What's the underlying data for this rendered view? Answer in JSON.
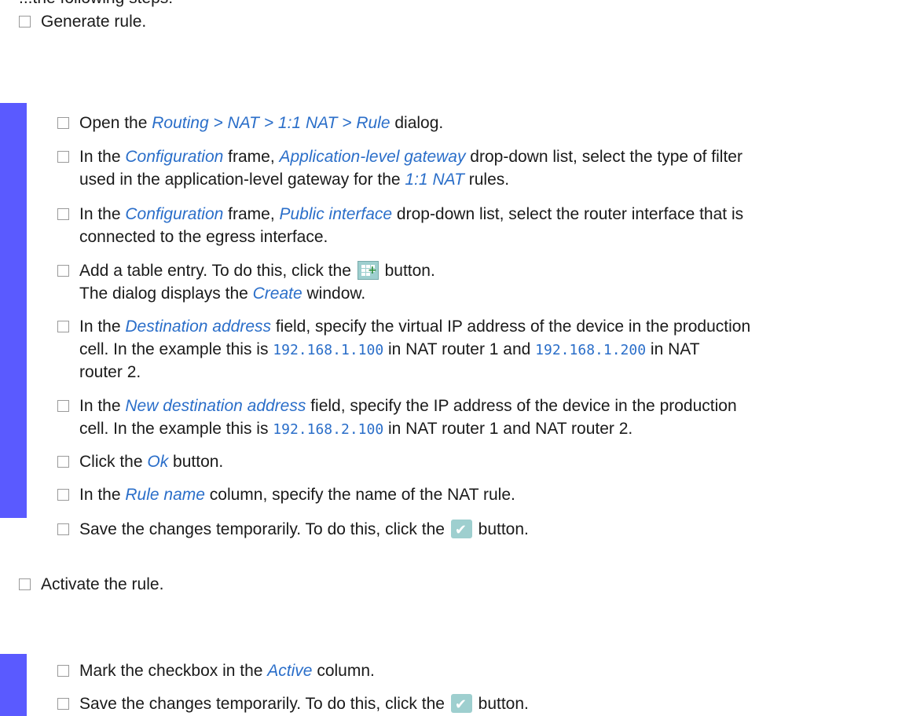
{
  "cut_top_text": "...the following steps:",
  "generate": {
    "label": "Generate rule.",
    "steps": {
      "s1": {
        "a": "Open the ",
        "em": "Routing > NAT > 1:1 NAT > Rule",
        "b": " dialog."
      },
      "s2": {
        "a": "In the ",
        "em1": "Configuration",
        "b": " frame, ",
        "em2": "Application-level gateway",
        "c": " drop-down list, select the type of filter",
        "line2a": "used in the application-level gateway for the ",
        "em3": "1:1 NAT",
        "line2b": " rules."
      },
      "s3": {
        "a": "In the ",
        "em1": "Configuration",
        "b": " frame, ",
        "em2": "Public interface",
        "c": " drop-down list, select the router interface that is",
        "line2": "connected to the egress interface."
      },
      "s4": {
        "a": "Add a table entry. To do this, click the ",
        "b": " button.",
        "line2a": "The dialog displays the ",
        "em": "Create",
        "line2b": " window."
      },
      "s5": {
        "a": "In the ",
        "em": "Destination address",
        "b": " field, specify the virtual IP address of the device in the production",
        "line2a": "cell. In the example this is ",
        "code1": "192.168.1.100",
        "line2b": " in NAT router 1 and ",
        "code2": "192.168.1.200",
        "line2c": " in NAT",
        "line3": "router 2."
      },
      "s6": {
        "a": "In the ",
        "em": "New destination address",
        "b": " field, specify the IP address of the device in the production",
        "line2a": "cell. In the example this is ",
        "code": "192.168.2.100",
        "line2b": " in NAT router 1 and NAT router 2."
      },
      "s7": {
        "a": "Click the ",
        "em": "Ok",
        "b": " button."
      },
      "s8": {
        "a": "In the ",
        "em": "Rule name",
        "b": " column, specify the name of the NAT rule."
      },
      "s9": {
        "a": "Save the changes temporarily. To do this, click the ",
        "b": " button."
      }
    }
  },
  "activate": {
    "label": "Activate the rule.",
    "steps": {
      "s1": {
        "a": "Mark the checkbox in the ",
        "em": "Active",
        "b": " column."
      },
      "s2": {
        "a": "Save the changes temporarily. To do this, click the ",
        "b": " button."
      }
    }
  },
  "icons": {
    "add_table_entry": "table-add-icon",
    "save": "checkmark-icon"
  },
  "colors": {
    "accent_bar": "#5a5aff",
    "emphasis": "#2a6ec9",
    "icon_bg": "#9ecfcf"
  }
}
